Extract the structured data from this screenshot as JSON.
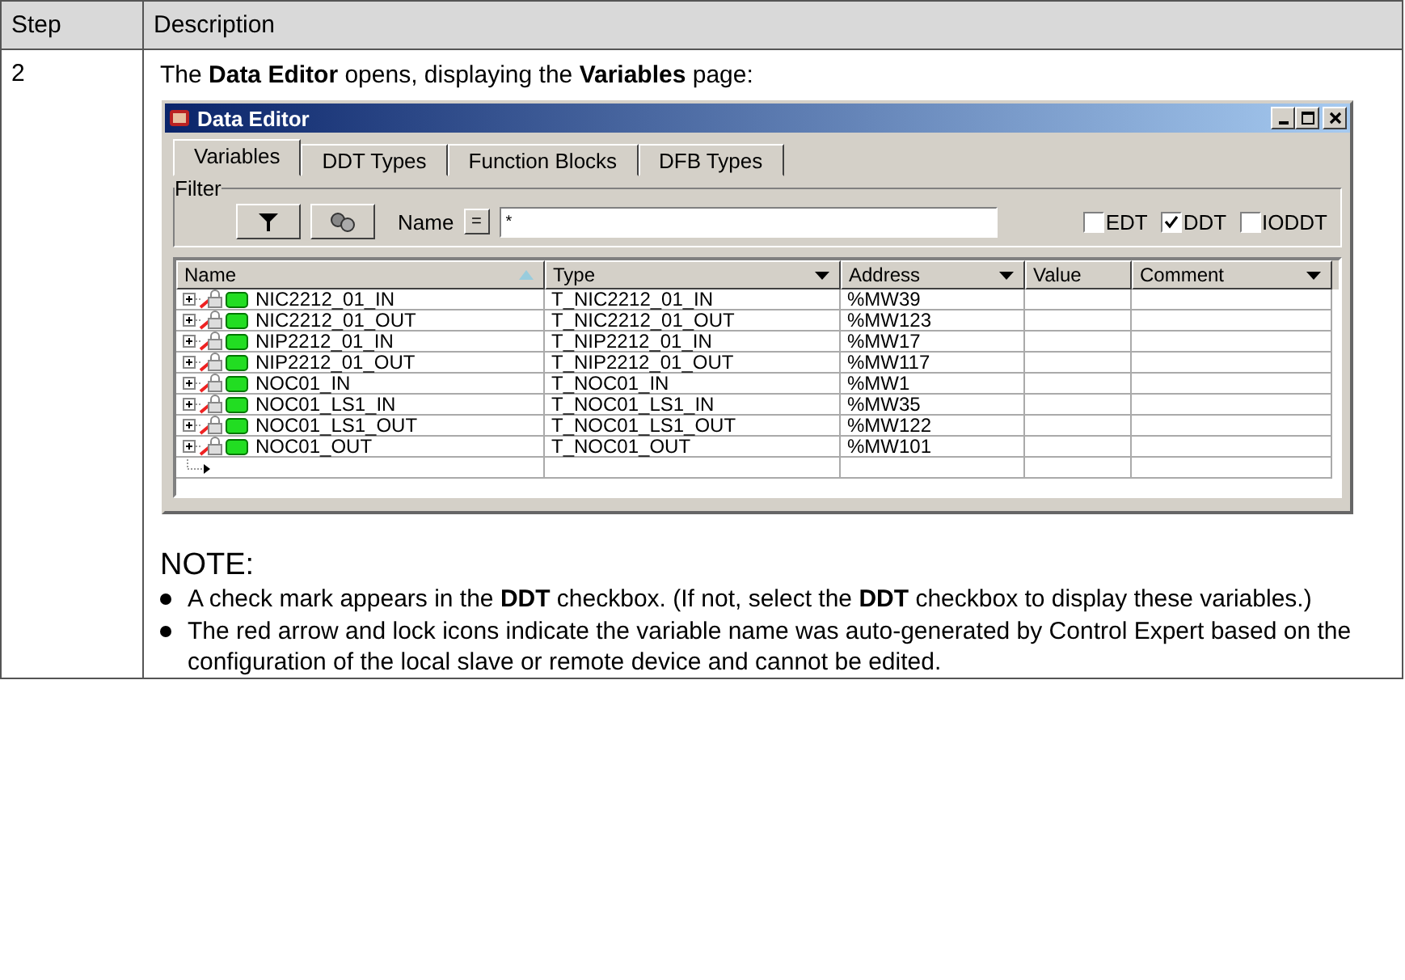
{
  "table": {
    "columns": [
      "Step",
      "Description"
    ],
    "rows": [
      {
        "step": "2",
        "intro": "The **Data Editor** opens, displaying the **Variables** page:",
        "window": {
          "title": "Data Editor",
          "tabs": [
            {
              "label": "Variables",
              "selected": true
            },
            {
              "label": "DDT Types",
              "selected": false
            },
            {
              "label": "Function Blocks",
              "selected": false
            },
            {
              "label": "DFB Types",
              "selected": false
            }
          ],
          "filter": {
            "label": "Filter",
            "name_label": "Name",
            "eq_button": "=",
            "value": "*",
            "checkboxes": [
              {
                "label": "EDT",
                "checked": false
              },
              {
                "label": "DDT",
                "checked": true
              },
              {
                "label": "IODDT",
                "checked": false
              }
            ]
          },
          "grid": {
            "columns": [
              {
                "label": "Name",
                "kind": "sort"
              },
              {
                "label": "Type",
                "kind": "dropdown"
              },
              {
                "label": "Address",
                "kind": "dropdown"
              },
              {
                "label": "Value",
                "kind": "plain"
              },
              {
                "label": "Comment",
                "kind": "dropdown"
              }
            ],
            "rows": [
              {
                "name": "NIC2212_01_IN",
                "type": "T_NIC2212_01_IN",
                "address": "%MW39"
              },
              {
                "name": "NIC2212_01_OUT",
                "type": "T_NIC2212_01_OUT",
                "address": "%MW123"
              },
              {
                "name": "NIP2212_01_IN",
                "type": "T_NIP2212_01_IN",
                "address": "%MW17"
              },
              {
                "name": "NIP2212_01_OUT",
                "type": "T_NIP2212_01_OUT",
                "address": "%MW117"
              },
              {
                "name": "NOC01_IN",
                "type": "T_NOC01_IN",
                "address": "%MW1"
              },
              {
                "name": "NOC01_LS1_IN",
                "type": "T_NOC01_LS1_IN",
                "address": "%MW35"
              },
              {
                "name": "NOC01_LS1_OUT",
                "type": "T_NOC01_LS1_OUT",
                "address": "%MW122"
              },
              {
                "name": "NOC01_OUT",
                "type": "T_NOC01_OUT",
                "address": "%MW101"
              }
            ]
          }
        },
        "note_title": "NOTE:",
        "notes": [
          "A check mark appears in the **DDT** checkbox. (If not, select the **DDT** checkbox to display these variables.)",
          "The red arrow and lock icons indicate the variable name was auto-generated by Control Expert based on the configuration of the local slave or remote device and cannot be edited."
        ]
      }
    ]
  }
}
